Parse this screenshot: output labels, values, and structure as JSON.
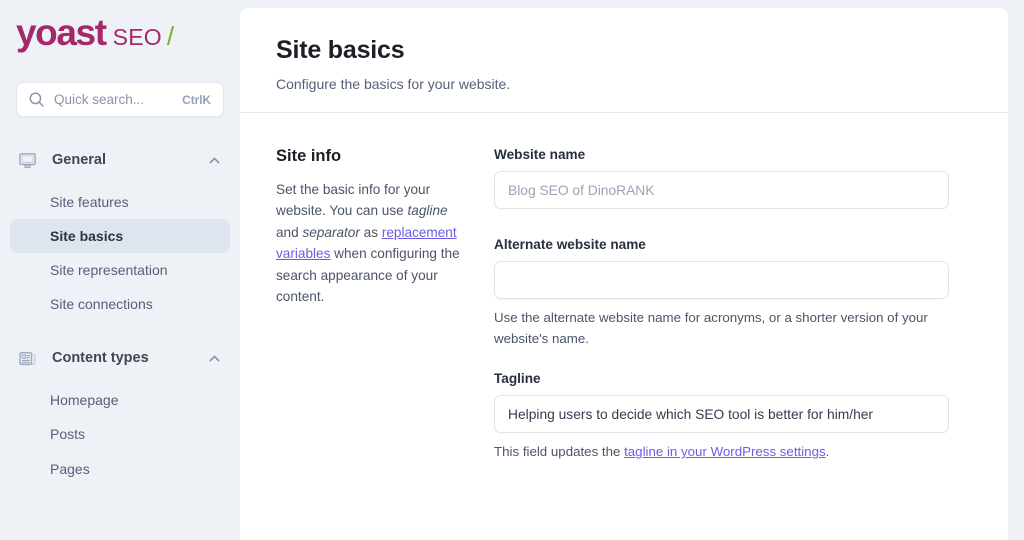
{
  "brand": {
    "name": "yoast",
    "product": "SEO",
    "slash": "/",
    "color_primary": "#a4286a",
    "color_accent": "#77b227"
  },
  "search": {
    "placeholder": "Quick search...",
    "shortcut": "CtrlK",
    "icon": "search-icon"
  },
  "sidebar": {
    "groups": [
      {
        "label": "General",
        "icon": "monitor-icon",
        "chevron": "chevron-up-icon",
        "items": [
          {
            "label": "Site features",
            "selected": false
          },
          {
            "label": "Site basics",
            "selected": true
          },
          {
            "label": "Site representation",
            "selected": false
          },
          {
            "label": "Site connections",
            "selected": false
          }
        ]
      },
      {
        "label": "Content types",
        "icon": "newspaper-icon",
        "chevron": "chevron-up-icon",
        "items": [
          {
            "label": "Homepage",
            "selected": false
          },
          {
            "label": "Posts",
            "selected": false
          },
          {
            "label": "Pages",
            "selected": false
          }
        ]
      }
    ]
  },
  "page": {
    "title": "Site basics",
    "subtitle": "Configure the basics for your website."
  },
  "site_info": {
    "heading": "Site info",
    "desc_part1": "Set the basic info for your website. You can use ",
    "desc_em1": "tagline",
    "desc_part2": " and ",
    "desc_em2": "separator",
    "desc_part3": " as ",
    "desc_link": "replacement variables",
    "desc_part4": " when configuring the search appearance of your content."
  },
  "fields": {
    "website_name": {
      "label": "Website name",
      "value": "",
      "placeholder": "Blog SEO of DinoRANK"
    },
    "alternate_website_name": {
      "label": "Alternate website name",
      "value": "",
      "placeholder": "",
      "help": "Use the alternate website name for acronyms, or a shorter version of your website's name."
    },
    "tagline": {
      "label": "Tagline",
      "value": "Helping users to decide which SEO tool is better for him/her",
      "placeholder": "",
      "help_prefix": "This field updates the ",
      "help_link": "tagline in your WordPress settings",
      "help_suffix": "."
    }
  }
}
